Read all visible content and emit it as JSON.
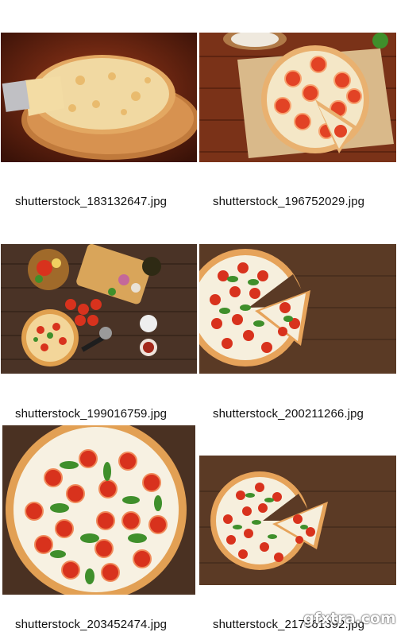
{
  "gallery": {
    "items": [
      {
        "filename": "shutterstock_183132647.jpg"
      },
      {
        "filename": "shutterstock_196752029.jpg"
      },
      {
        "filename": "shutterstock_199016759.jpg"
      },
      {
        "filename": "shutterstock_200211266.jpg"
      },
      {
        "filename": "shutterstock_203452474.jpg"
      },
      {
        "filename": "shutterstock_217661392.jpg"
      }
    ]
  },
  "watermark": {
    "text": "gfxtra.com"
  },
  "colors": {
    "wood_dark": "#5a2a12",
    "wood_brown": "#5b3a25",
    "crust": "#e3a862",
    "cheese": "#f3e7c4",
    "tomato": "#d8321d",
    "basil": "#3f8f2b",
    "mozzarella": "#fbf8ef"
  }
}
